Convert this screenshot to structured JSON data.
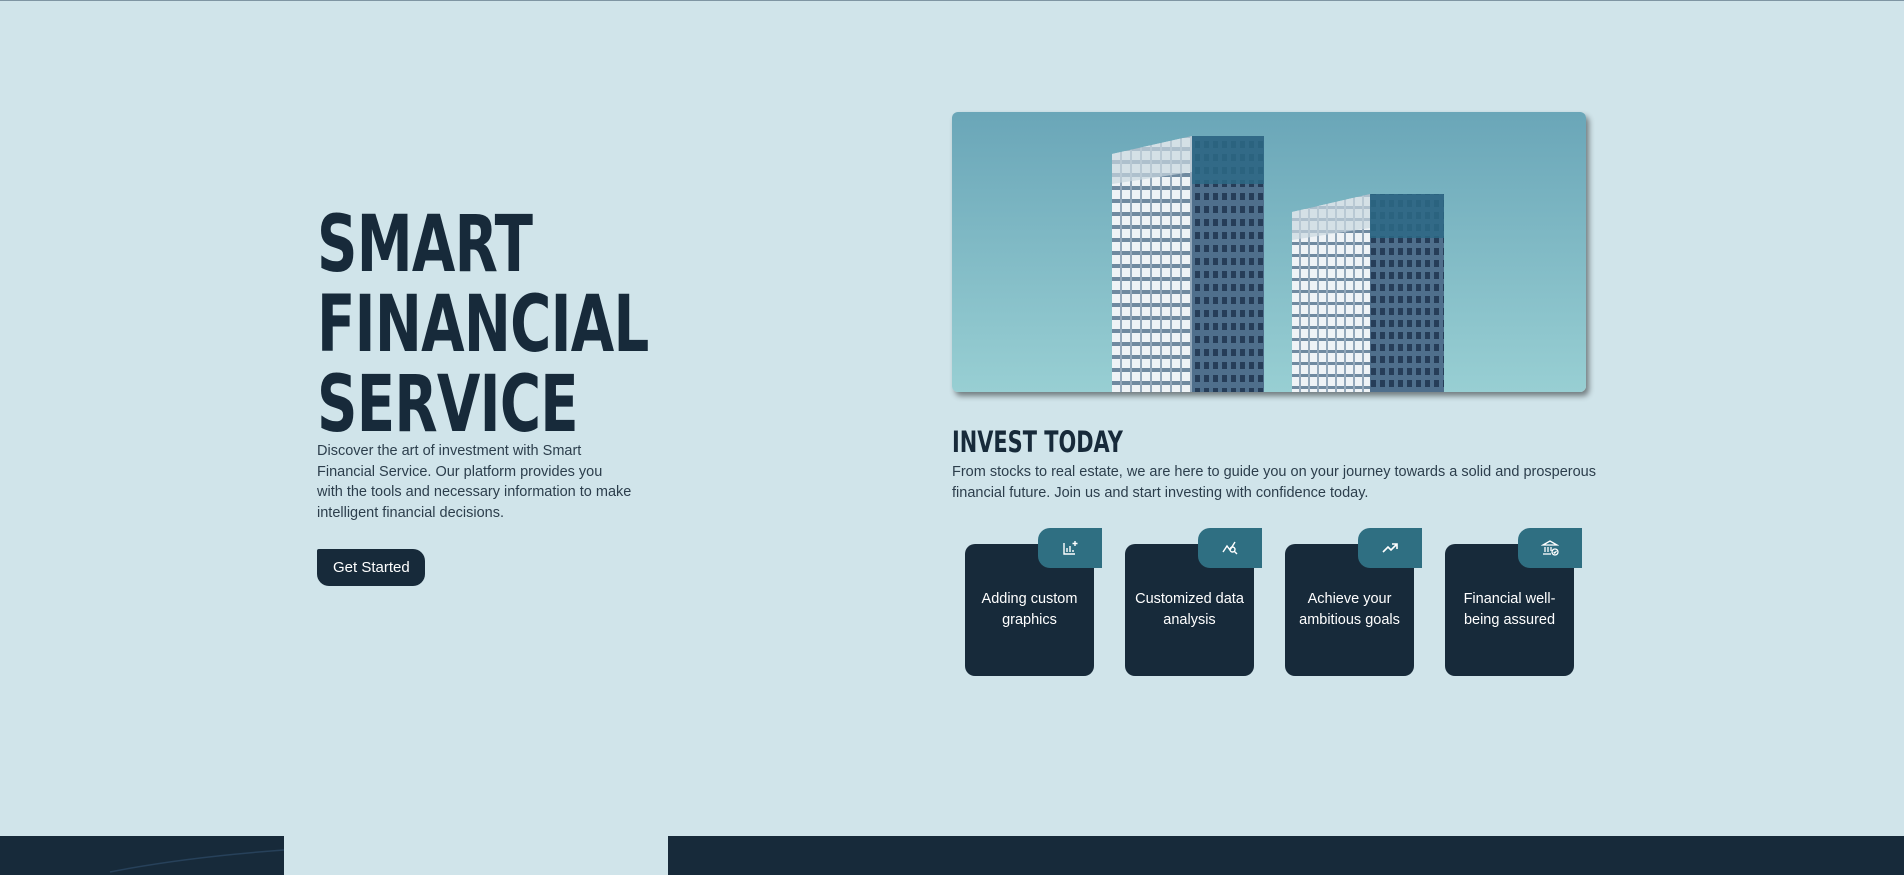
{
  "hero": {
    "title_line1": "SMART",
    "title_line2": "FINANCIAL",
    "title_line3": "SERVICE",
    "description": "Discover the art of investment with Smart Financial Service. Our platform provides you with the tools and necessary information to make intelligent financial decisions.",
    "cta_label": "Get Started"
  },
  "invest": {
    "title": "INVEST TODAY",
    "description": "From stocks to real estate, we are here to guide you on your journey towards a solid and prosperous financial future. Join us and start investing with confidence today."
  },
  "features": [
    {
      "label": "Adding custom graphics",
      "icon": "chart-add-icon"
    },
    {
      "label": "Customized data analysis",
      "icon": "chart-search-icon"
    },
    {
      "label": "Achieve your ambitious goals",
      "icon": "trending-up-icon"
    },
    {
      "label": "Financial well-being assured",
      "icon": "bank-check-icon"
    }
  ],
  "colors": {
    "background": "#d0e4ea",
    "dark_navy": "#172a3a",
    "accent_teal": "#2f6f82"
  }
}
